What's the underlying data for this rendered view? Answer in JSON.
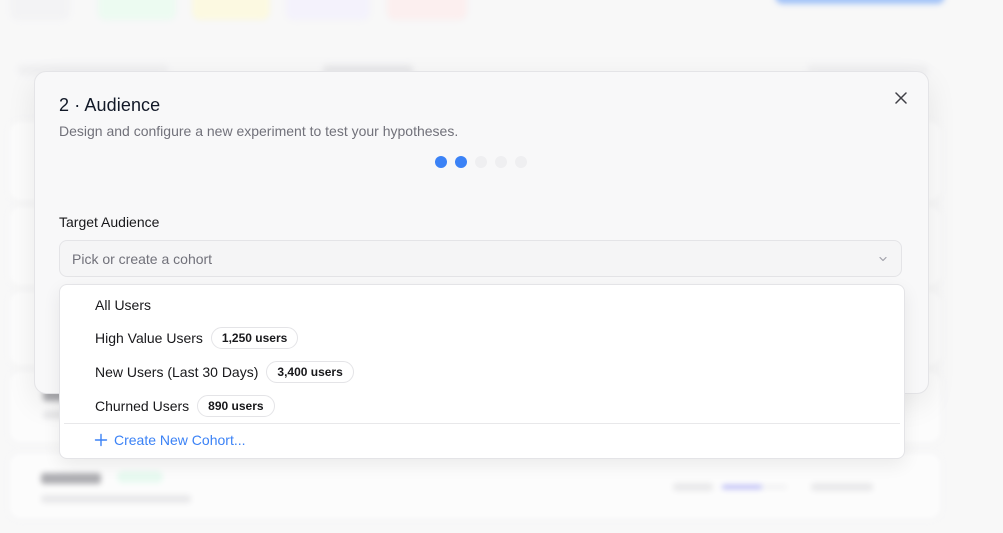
{
  "modal": {
    "title": "2 · Audience",
    "description": "Design and configure a new experiment to test your hypotheses.",
    "steps": {
      "total": 5,
      "current": 2
    }
  },
  "form": {
    "target_label": "Target Audience",
    "target_placeholder": "Pick or create a cohort"
  },
  "dropdown": {
    "options": [
      {
        "label": "All Users",
        "count": ""
      },
      {
        "label": "High Value Users",
        "count": "1,250 users"
      },
      {
        "label": "New Users (Last 30 Days)",
        "count": "3,400 users"
      },
      {
        "label": "Churned Users",
        "count": "890 users"
      }
    ],
    "create_label": "Create New Cohort..."
  },
  "colors": {
    "accent": "#3b82f6",
    "step_inactive": "#efeff1"
  },
  "icons": {
    "close": "close-icon",
    "chevron": "chevron-down-icon",
    "plus": "plus-icon"
  }
}
